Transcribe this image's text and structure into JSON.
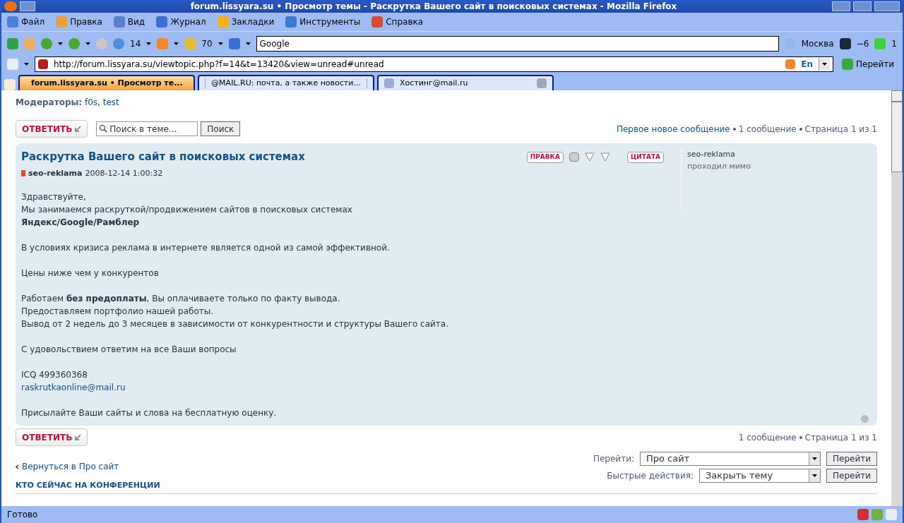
{
  "window": {
    "title": "forum.lissyara.su • Просмотр темы - Раскрутка Вашего сайт в поисковых системах - Mozilla Firefox"
  },
  "menu": [
    "Файл",
    "Правка",
    "Вид",
    "Журнал",
    "Закладки",
    "Инструменты",
    "Справка"
  ],
  "toolbar": {
    "counter_1": "14",
    "counter_2": "70",
    "search_value": "Google",
    "city": "Москва",
    "temperature": "−6",
    "traffic": "1"
  },
  "address": {
    "url": "http://forum.lissyara.su/viewtopic.php?f=14&t=13420&view=unread#unread",
    "lang": "En",
    "go": "Перейти"
  },
  "tabs": [
    {
      "label": "forum.lissyara.su • Просмотр те...",
      "selected": true
    },
    {
      "label": "@MAIL.RU: почта, а также новости...",
      "selected": false
    },
    {
      "label": "Хостинг@mail.ru",
      "selected": false
    }
  ],
  "moderators": {
    "label": "Модераторы:",
    "names": "f0s, test"
  },
  "reply_button_top": "ОТВЕТИТЬ",
  "reply_button_bottom": "ОТВЕТИТЬ",
  "topic_search": {
    "placeholder": "Поиск в теме...",
    "button": "Поиск"
  },
  "pagination_top": {
    "first_new": "Первое новое сообщение",
    "count": "1 сообщение",
    "page": "Страница 1 из 1"
  },
  "post": {
    "title": "Раскрутка Вашего сайт в поисковых системах",
    "author": "seo-reklama",
    "date": "2008-12-14 1:00:32",
    "edit": "ПРАВКА",
    "quote": "ЦИТАТА",
    "profile_name": "seo-reklama",
    "profile_rank": "проходил мимо",
    "paragraphs": [
      [
        {
          "kind": "text",
          "text": "Здравствуйте,"
        },
        {
          "kind": "text",
          "text": "Мы занимаемся раскруткой/продвижением сайтов в поисковых системах"
        },
        {
          "kind": "bold",
          "text": "Яндекс/Google/Рамблер"
        }
      ],
      [
        {
          "kind": "text",
          "text": "В условиях кризиса реклама в интернете является одной из самой эффективной."
        }
      ],
      [
        {
          "kind": "text",
          "text": "Цены ниже чем у конкурентов"
        }
      ],
      [
        {
          "kind": "text",
          "text": "Работаем **без предоплаты**, Вы оплачиваете только по факту вывода."
        },
        {
          "kind": "text",
          "text": "Предоставляем портфолио нашей работы."
        },
        {
          "kind": "text",
          "text": "Вывод от 2 недель до 3 месяцев в зависимости от конкурентности и структуры Вашего сайта."
        }
      ],
      [
        {
          "kind": "text",
          "text": "С удовольствием ответим на все Ваши вопросы"
        }
      ],
      [
        {
          "kind": "text",
          "text": "ICQ 499360368"
        },
        {
          "kind": "link",
          "text": "raskrutkaonline@mail.ru"
        }
      ],
      [
        {
          "kind": "text",
          "text": "Присылайте Ваши сайты и слова на бесплатную оценку."
        }
      ]
    ]
  },
  "pagination_bottom": {
    "count": "1 сообщение",
    "page": "Страница 1 из 1"
  },
  "back_link": "Вернуться в Про сайт",
  "jump": {
    "label": "Перейти:",
    "value": "Про сайт",
    "button": "Перейти"
  },
  "quick": {
    "label": "Быстрые действия:",
    "value": "Закрыть тему",
    "button": "Перейти"
  },
  "who_online": "КТО СЕЙЧАС НА КОНФЕРЕНЦИИ",
  "status": "Готово"
}
